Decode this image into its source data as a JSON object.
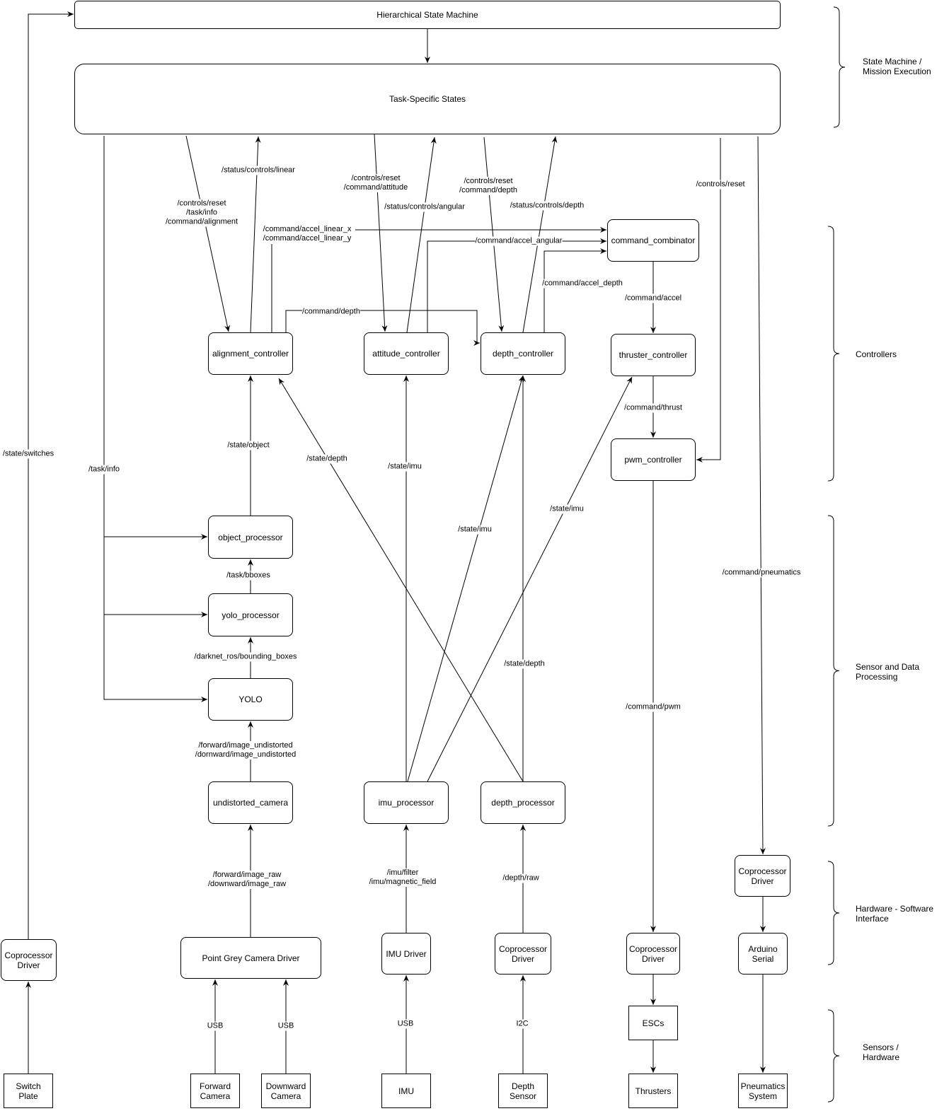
{
  "nodes": {
    "hsm": {
      "label": "Hierarchical State Machine"
    },
    "tss": {
      "label": "Task-Specific States"
    },
    "alignment_controller": {
      "label": "alignment_controller"
    },
    "attitude_controller": {
      "label": "attitude_controller"
    },
    "depth_controller": {
      "label": "depth_controller"
    },
    "command_combinator": {
      "label": "command_combinator"
    },
    "thruster_controller": {
      "label": "thruster_controller"
    },
    "pwm_controller": {
      "label": "pwm_controller"
    },
    "object_processor": {
      "label": "object_processor"
    },
    "yolo_processor": {
      "label": "yolo_processor"
    },
    "yolo": {
      "label": "YOLO"
    },
    "undistorted_camera": {
      "label": "undistorted_camera"
    },
    "imu_processor": {
      "label": "imu_processor"
    },
    "depth_processor": {
      "label": "depth_processor"
    },
    "coprocessor_switch": {
      "label": "Coprocessor\nDriver"
    },
    "point_grey": {
      "label": "Point Grey Camera Driver"
    },
    "imu_driver": {
      "label": "IMU Driver"
    },
    "coprocessor_depth": {
      "label": "Coprocessor\nDriver"
    },
    "coprocessor_thrusters": {
      "label": "Coprocessor\nDriver"
    },
    "coprocessor_pneumatics": {
      "label": "Coprocessor\nDriver"
    },
    "arduino_serial": {
      "label": "Arduino\nSerial"
    },
    "switch_plate": {
      "label": "Switch\nPlate"
    },
    "forward_camera": {
      "label": "Forward\nCamera"
    },
    "downward_camera": {
      "label": "Downward\nCamera"
    },
    "imu": {
      "label": "IMU"
    },
    "depth_sensor": {
      "label": "Depth\nSensor"
    },
    "escs": {
      "label": "ESCs"
    },
    "thrusters": {
      "label": "Thrusters"
    },
    "pneumatics_system": {
      "label": "Pneumatics\nSystem"
    }
  },
  "edges": [
    {
      "from": "switch_plate",
      "to": "coprocessor_switch",
      "label": ""
    },
    {
      "from": "coprocessor_switch",
      "to": "hsm",
      "label": "/state/switches"
    },
    {
      "from": "hsm",
      "to": "tss",
      "label": ""
    },
    {
      "from": "tss",
      "to": "alignment_controller",
      "label": "/controls/reset\n/task/info\n/command/alignment"
    },
    {
      "from": "alignment_controller",
      "to": "tss",
      "label": "/status/controls/linear"
    },
    {
      "from": "tss",
      "to": "attitude_controller",
      "label": "/controls/reset\n/command/attitude"
    },
    {
      "from": "attitude_controller",
      "to": "tss",
      "label": "/status/controls/angular"
    },
    {
      "from": "tss",
      "to": "depth_controller",
      "label": "/controls/reset\n/command/depth"
    },
    {
      "from": "depth_controller",
      "to": "tss",
      "label": "/status/controls/depth"
    },
    {
      "from": "tss",
      "to": "pwm_controller",
      "label": "/controls/reset"
    },
    {
      "from": "tss",
      "to": "coprocessor_pneumatics",
      "label": "/command/pneumatics"
    },
    {
      "from": "tss",
      "to": "yolo",
      "label": "/task/info"
    },
    {
      "from": "alignment_controller",
      "to": "command_combinator",
      "label": "/command/accel_linear_x\n/command/accel_linear_y"
    },
    {
      "from": "attitude_controller",
      "to": "command_combinator",
      "label": "/command/accel_angular"
    },
    {
      "from": "depth_controller",
      "to": "command_combinator",
      "label": "/command/accel_depth"
    },
    {
      "from": "alignment_controller",
      "to": "depth_controller",
      "label": "/command/depth"
    },
    {
      "from": "command_combinator",
      "to": "thruster_controller",
      "label": "/command/accel"
    },
    {
      "from": "thruster_controller",
      "to": "pwm_controller",
      "label": "/command/thrust"
    },
    {
      "from": "pwm_controller",
      "to": "coprocessor_thrusters",
      "label": "/command/pwm"
    },
    {
      "from": "coprocessor_thrusters",
      "to": "escs",
      "label": ""
    },
    {
      "from": "escs",
      "to": "thrusters",
      "label": ""
    },
    {
      "from": "coprocessor_pneumatics",
      "to": "arduino_serial",
      "label": ""
    },
    {
      "from": "arduino_serial",
      "to": "pneumatics_system",
      "label": ""
    },
    {
      "from": "object_processor",
      "to": "alignment_controller",
      "label": "/state/object"
    },
    {
      "from": "yolo_processor",
      "to": "object_processor",
      "label": "/task/bboxes"
    },
    {
      "from": "yolo",
      "to": "yolo_processor",
      "label": "/darknet_ros/bounding_boxes"
    },
    {
      "from": "undistorted_camera",
      "to": "yolo",
      "label": "/forward/image_undistorted\n/dornward/image_undistorted"
    },
    {
      "from": "point_grey",
      "to": "undistorted_camera",
      "label": "/forward/image_raw\n/downward/image_raw"
    },
    {
      "from": "forward_camera",
      "to": "point_grey",
      "label": "USB"
    },
    {
      "from": "downward_camera",
      "to": "point_grey",
      "label": "USB"
    },
    {
      "from": "imu",
      "to": "imu_driver",
      "label": "USB"
    },
    {
      "from": "depth_sensor",
      "to": "coprocessor_depth",
      "label": "I2C"
    },
    {
      "from": "imu_driver",
      "to": "imu_processor",
      "label": "/imu/filter\n/imu/magnetic_field"
    },
    {
      "from": "coprocessor_depth",
      "to": "depth_processor",
      "label": "/depth/raw"
    },
    {
      "from": "imu_processor",
      "to": "attitude_controller",
      "label": "/state/imu"
    },
    {
      "from": "imu_processor",
      "to": "depth_controller",
      "label": "/state/imu"
    },
    {
      "from": "imu_processor",
      "to": "thruster_controller",
      "label": "/state/imu"
    },
    {
      "from": "depth_processor",
      "to": "alignment_controller",
      "label": "/state/depth"
    },
    {
      "from": "depth_processor",
      "to": "depth_controller",
      "label": "/state/depth"
    }
  ],
  "groups": [
    {
      "label": "State Machine /\nMission Execution"
    },
    {
      "label": "Controllers"
    },
    {
      "label": "Sensor and Data\nProcessing"
    },
    {
      "label": "Hardware - Software\nInterface"
    },
    {
      "label": "Sensors /\nHardware"
    }
  ]
}
